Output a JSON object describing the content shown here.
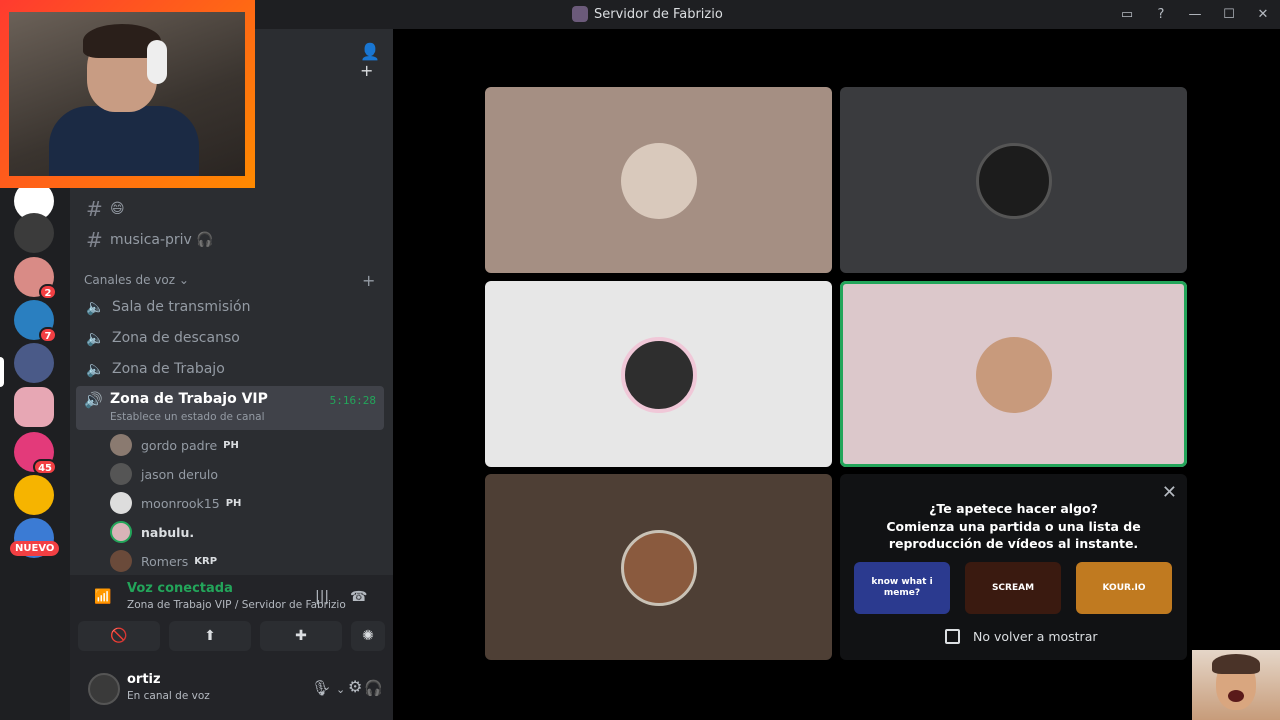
{
  "window": {
    "title": "Servidor de Fabrizio"
  },
  "servers": [
    {
      "badge": ""
    },
    {
      "badge": ""
    },
    {
      "badge": "2"
    },
    {
      "badge": "7"
    },
    {
      "badge": ""
    },
    {
      "badge": ""
    },
    {
      "badge": "45"
    },
    {
      "badge": ""
    }
  ],
  "servers_new_label": "NUEVO",
  "channels": {
    "text": [
      {
        "name": "😄"
      },
      {
        "name": "musica-priv 🎧"
      }
    ],
    "voice_category": "Canales de voz",
    "voice": [
      {
        "name": "Sala de transmisión"
      },
      {
        "name": "Zona de descanso"
      },
      {
        "name": "Zona de Trabajo"
      }
    ],
    "active": {
      "name": "Zona de Trabajo VIP",
      "status": "Establece un estado de canal",
      "timer": "5:16:28"
    },
    "members": [
      {
        "name": "gordo padre",
        "tag": "PH"
      },
      {
        "name": "jason derulo",
        "tag": ""
      },
      {
        "name": "moonrook15",
        "tag": "PH"
      },
      {
        "name": "nabulu.",
        "tag": ""
      },
      {
        "name": "Romers",
        "tag": "KRP"
      }
    ]
  },
  "voice_panel": {
    "title": "Voz conectada",
    "subtitle": "Zona de Trabajo VIP / Servidor de Fabrizio"
  },
  "user": {
    "name": "ortiz",
    "status": "En canal de voz"
  },
  "activity": {
    "close": "✕",
    "heading": "¿Te apetece hacer algo?",
    "body": "Comienza una partida o una lista de reproducción de vídeos al instante.",
    "games": [
      {
        "label": "know what i meme?",
        "color": "#2b3a8f"
      },
      {
        "label": "SCREAM",
        "color": "#3a1a10"
      },
      {
        "label": "KOUR.IO",
        "color": "#c07a20"
      }
    ],
    "checkbox_label": "No volver a mostrar"
  },
  "colors": {
    "accent_green": "#23a55a",
    "sidebar": "#2b2d31",
    "servers": "#1e1f22"
  }
}
